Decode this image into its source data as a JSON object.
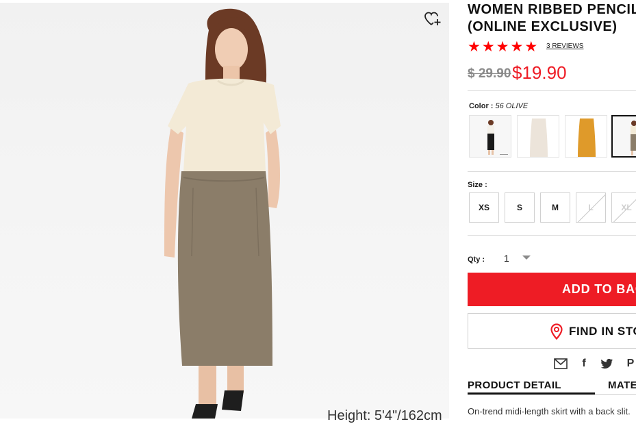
{
  "product": {
    "title": "WOMEN RIBBED PENCIL M\n(ONLINE EXCLUSIVE)",
    "rating_stars": 5,
    "reviews_text": "3 REVIEWS",
    "original_price": "$ 29.90",
    "sale_price": "$19.90",
    "image_caption": "Height: 5'4\"/162cm",
    "colors": {
      "accent": "#ee1c25",
      "star": "#ff0000"
    }
  },
  "color": {
    "label": "Color :",
    "selected_value": "56 OLIVE",
    "swatches": [
      "black",
      "off-white",
      "mustard",
      "olive"
    ]
  },
  "size": {
    "label": "Size :",
    "options": [
      {
        "label": "XS",
        "available": true
      },
      {
        "label": "S",
        "available": true
      },
      {
        "label": "M",
        "available": true
      },
      {
        "label": "L",
        "available": false
      },
      {
        "label": "XL",
        "available": false
      }
    ]
  },
  "quantity": {
    "label": "Qty :",
    "value": "1"
  },
  "actions": {
    "add_to_bag": "ADD TO BAG",
    "find_in_store": "FIND IN STORE"
  },
  "share": {
    "icons": [
      "mail-icon",
      "facebook-icon",
      "twitter-icon",
      "pinterest-icon"
    ]
  },
  "tabs": [
    {
      "label": "PRODUCT DETAIL",
      "active": true
    },
    {
      "label": "MATERIAL",
      "active": false
    }
  ],
  "description": "On-trend midi-length skirt with a back slit."
}
